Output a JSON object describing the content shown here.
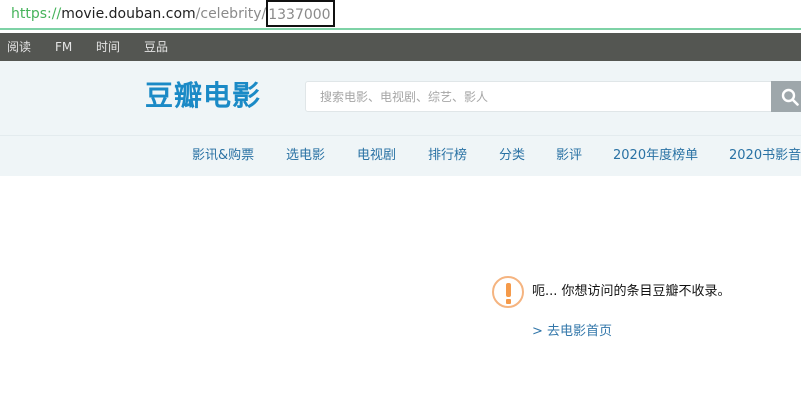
{
  "browser": {
    "url_scheme": "https://",
    "url_host": "movie.douban.com",
    "url_path": "/celebrity/",
    "url_id": "1337000"
  },
  "topnav": {
    "items": [
      "阅读",
      "FM",
      "时间",
      "豆品"
    ]
  },
  "header": {
    "logo": "豆瓣电影",
    "search_placeholder": "搜索电影、电视剧、综艺、影人",
    "subnav": [
      "影讯&购票",
      "选电影",
      "电视剧",
      "排行榜",
      "分类",
      "影评",
      "2020年度榜单",
      "2020书影音"
    ]
  },
  "message": {
    "text": "呃... 你想访问的条目豆瓣不收录。",
    "link": "> 去电影首页"
  },
  "colors": {
    "brand_blue": "#1b8ac6",
    "link_blue": "#3377aa",
    "warning_orange": "#f59a4a",
    "topnav_bg": "#545652"
  }
}
